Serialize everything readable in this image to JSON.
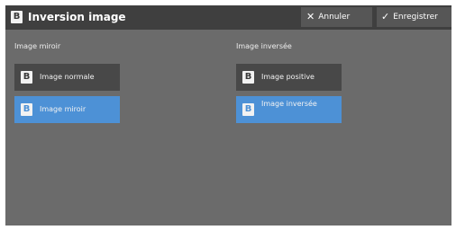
{
  "header": {
    "title_icon": "B",
    "title": "Inversion image",
    "cancel_label": "Annuler",
    "save_label": "Enregistrer"
  },
  "left_group": {
    "label": "Image miroir",
    "options": [
      {
        "icon": "B",
        "label": "Image normale",
        "selected": false
      },
      {
        "icon": "B",
        "label": "Image miroir",
        "selected": true
      }
    ]
  },
  "right_group": {
    "label": "Image inversée",
    "options": [
      {
        "icon": "B",
        "label": "Image positive",
        "selected": false
      },
      {
        "icon": "B",
        "label": "Image inversée",
        "selected": true
      }
    ]
  },
  "colors": {
    "header_bg": "#3f3f3f",
    "panel_bg": "#6b6b6b",
    "option_bg": "#484848",
    "selected_bg": "#4d91d6"
  },
  "icons": {
    "cancel": "close-icon",
    "save": "checkmark-icon",
    "option": "b-letter-icon"
  }
}
